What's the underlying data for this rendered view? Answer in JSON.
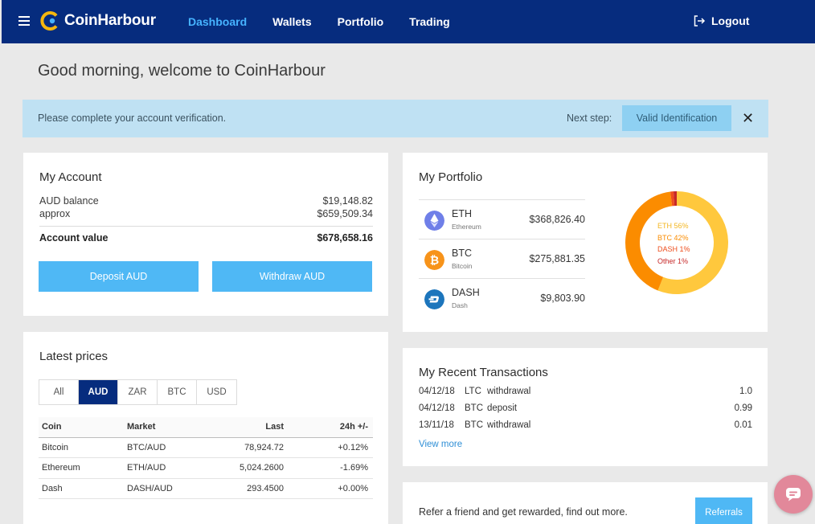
{
  "brand": {
    "name": "CoinHarbour"
  },
  "nav": {
    "items": [
      {
        "label": "Dashboard",
        "active": true
      },
      {
        "label": "Wallets"
      },
      {
        "label": "Portfolio"
      },
      {
        "label": "Trading"
      }
    ],
    "logout_label": "Logout"
  },
  "greeting": "Good morning, welcome to CoinHarbour",
  "alert": {
    "message": "Please complete your account verification.",
    "next_step_label": "Next step:",
    "button_label": "Valid Identification",
    "close_glyph": "✕"
  },
  "account": {
    "title": "My Account",
    "rows": [
      {
        "label": "AUD balance",
        "value": "$19,148.82"
      },
      {
        "label": "approx",
        "value": "$659,509.34"
      }
    ],
    "total_label": "Account value",
    "total_value": "$678,658.16",
    "deposit_label": "Deposit AUD",
    "withdraw_label": "Withdraw AUD"
  },
  "prices": {
    "title": "Latest prices",
    "tabs": [
      "All",
      "AUD",
      "ZAR",
      "BTC",
      "USD"
    ],
    "active_tab": "AUD",
    "headers": [
      "Coin",
      "Market",
      "Last",
      "24h +/-"
    ],
    "rows": [
      {
        "coin": "Bitcoin",
        "market": "BTC/AUD",
        "last": "78,924.72",
        "change": "+0.12%"
      },
      {
        "coin": "Ethereum",
        "market": "ETH/AUD",
        "last": "5,024.2600",
        "change": "-1.69%"
      },
      {
        "coin": "Dash",
        "market": "DASH/AUD",
        "last": "293.4500",
        "change": "+0.00%"
      }
    ]
  },
  "portfolio": {
    "title": "My Portfolio",
    "holdings": [
      {
        "symbol": "ETH",
        "name": "Ethereum",
        "value": "$368,826.40",
        "icon": "ethereum-icon",
        "color": "#6f7fe8"
      },
      {
        "symbol": "BTC",
        "name": "Bitcoin",
        "value": "$275,881.35",
        "icon": "bitcoin-icon",
        "color": "#f7931a"
      },
      {
        "symbol": "DASH",
        "name": "Dash",
        "value": "$9,803.90",
        "icon": "dash-icon",
        "color": "#1c75bc"
      }
    ],
    "legend": [
      {
        "label": "ETH 56%",
        "share": 56,
        "color": "#ffc83d"
      },
      {
        "label": "BTC 42%",
        "share": 42,
        "color": "#fb8c00"
      },
      {
        "label": "DASH 1%",
        "share": 1,
        "color": "#ee4d1c"
      },
      {
        "label": "Other 1%",
        "share": 1,
        "color": "#c62828"
      }
    ]
  },
  "transactions": {
    "title": "My Recent Transactions",
    "rows": [
      {
        "date": "04/12/18",
        "coin": "LTC",
        "type": "withdrawal",
        "amount": "1.0"
      },
      {
        "date": "04/12/18",
        "coin": "BTC",
        "type": "deposit",
        "amount": "0.99"
      },
      {
        "date": "13/11/18",
        "coin": "BTC",
        "type": "withdrawal",
        "amount": "0.01"
      }
    ],
    "view_more_label": "View more"
  },
  "referral": {
    "text": "Refer a friend and get rewarded, find out more.",
    "button_label": "Referrals"
  }
}
